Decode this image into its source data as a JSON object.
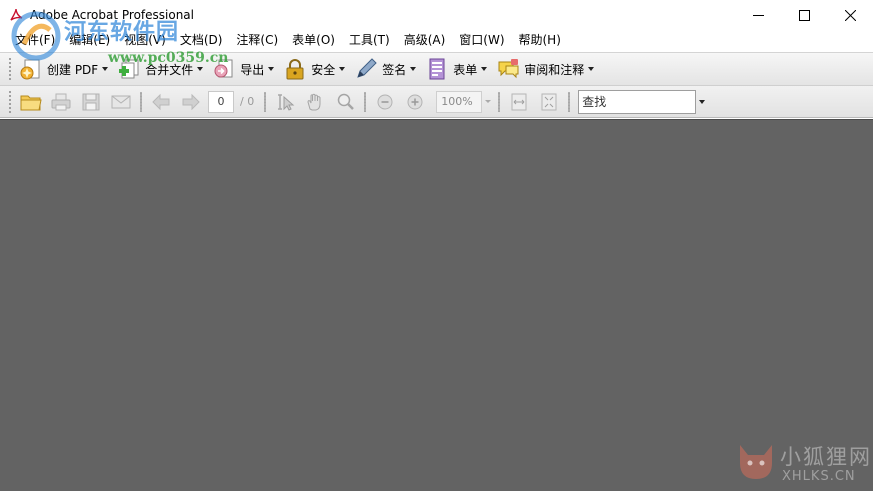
{
  "window": {
    "title": "Adobe Acrobat Professional",
    "controls": {
      "minimize": "minimize-icon",
      "maximize": "maximize-icon",
      "close": "close-icon"
    }
  },
  "menubar": {
    "items": [
      "文件(F)",
      "编辑(E)",
      "视图(V)",
      "文档(D)",
      "注释(C)",
      "表单(O)",
      "工具(T)",
      "高级(A)",
      "窗口(W)",
      "帮助(H)"
    ]
  },
  "toolbar1": {
    "buttons": [
      {
        "label": "创建 PDF",
        "icon": "create-pdf-icon"
      },
      {
        "label": "合并文件",
        "icon": "combine-files-icon"
      },
      {
        "label": "导出",
        "icon": "export-icon"
      },
      {
        "label": "安全",
        "icon": "lock-icon"
      },
      {
        "label": "签名",
        "icon": "pen-icon"
      },
      {
        "label": "表单",
        "icon": "form-icon"
      },
      {
        "label": "审阅和注释",
        "icon": "comment-icon"
      }
    ]
  },
  "toolbar2": {
    "page_number": "0",
    "page_total": "/ 0",
    "zoom": "100%",
    "search_value": "查找"
  },
  "watermarks": {
    "top_left_text": "河东软件园",
    "top_left_url": "www.pc0359.cn",
    "bottom_right_cn": "小狐狸网",
    "bottom_right_en": "XHLKS.CN"
  },
  "colors": {
    "document_area": "#636363",
    "toolbar_bg": "#ececec"
  }
}
